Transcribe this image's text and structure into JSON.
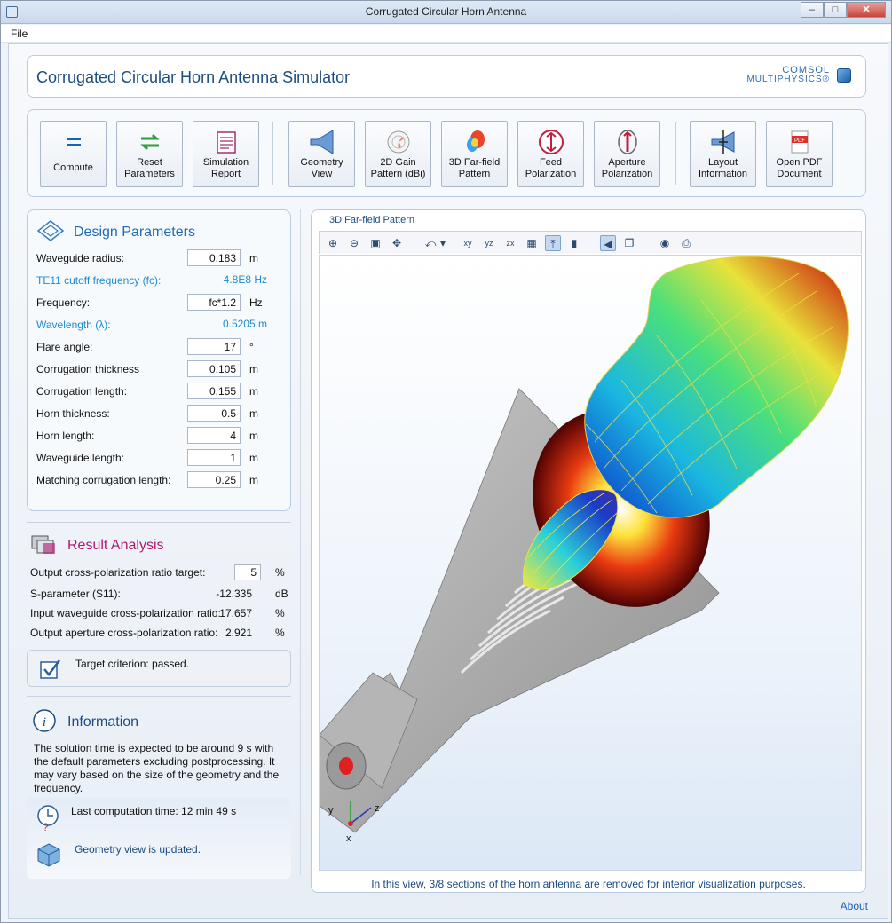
{
  "window": {
    "title": "Corrugated Circular Horn Antenna"
  },
  "menu": {
    "file": "File"
  },
  "header": {
    "app_title": "Corrugated Circular Horn Antenna Simulator",
    "logo_line1": "COMSOL",
    "logo_line2": "MULTIPHYSICS®"
  },
  "toolbar": {
    "compute": "Compute",
    "reset": "Reset\nParameters",
    "report": "Simulation\nReport",
    "geometry": "Geometry\nView",
    "gain2d": "2D Gain\nPattern (dBi)",
    "farfield3d": "3D Far-field\nPattern",
    "feedpol": "Feed\nPolarization",
    "apertpol": "Aperture\nPolarization",
    "layout": "Layout\nInformation",
    "pdf": "Open PDF\nDocument"
  },
  "design": {
    "title": "Design Parameters",
    "rows": [
      {
        "label": "Waveguide radius:",
        "value": "0.183",
        "unit": "m"
      },
      {
        "label": "TE11 cutoff frequency (fc):",
        "value": "4.8E8 Hz",
        "unit": ""
      },
      {
        "label": "Frequency:",
        "value": "fc*1.2",
        "unit": "Hz"
      },
      {
        "label": "Wavelength (λ):",
        "value": "0.5205 m",
        "unit": ""
      },
      {
        "label": "Flare angle:",
        "value": "17",
        "unit": "°"
      },
      {
        "label": "Corrugation thickness",
        "value": "0.105",
        "unit": "m"
      },
      {
        "label": "Corrugation length:",
        "value": "0.155",
        "unit": "m"
      },
      {
        "label": "Horn thickness:",
        "value": "0.5",
        "unit": "m"
      },
      {
        "label": "Horn length:",
        "value": "4",
        "unit": "m"
      },
      {
        "label": "Waveguide length:",
        "value": "1",
        "unit": "m"
      },
      {
        "label": "Matching corrugation length:",
        "value": "0.25",
        "unit": "m"
      }
    ]
  },
  "results": {
    "title": "Result Analysis",
    "target_label": "Output cross-polarization ratio target:",
    "target_value": "5",
    "target_unit": "%",
    "s11_label": "S-parameter (S11):",
    "s11_value": "-12.335",
    "s11_unit": "dB",
    "in_label": "Input waveguide cross-polarization ratio:",
    "in_value": "17.657",
    "in_unit": "%",
    "out_label": "Output aperture cross-polarization ratio:",
    "out_value": "2.921",
    "out_unit": "%",
    "criterion": "Target criterion: passed."
  },
  "info": {
    "title": "Information",
    "text": "The solution time is expected to be around 9 s with the default parameters excluding postprocessing. It may vary based on the size of the geometry and the frequency.",
    "last_time": "Last computation time: 12 min 49 s",
    "geom_status": "Geometry view is updated."
  },
  "graphics": {
    "title": "3D Far-field Pattern",
    "caption": "In this view, 3/8 sections of the horn antenna are removed for interior visualization purposes.",
    "axis_x": "x",
    "axis_y": "y",
    "axis_z": "z"
  },
  "footer": {
    "about": "About"
  }
}
